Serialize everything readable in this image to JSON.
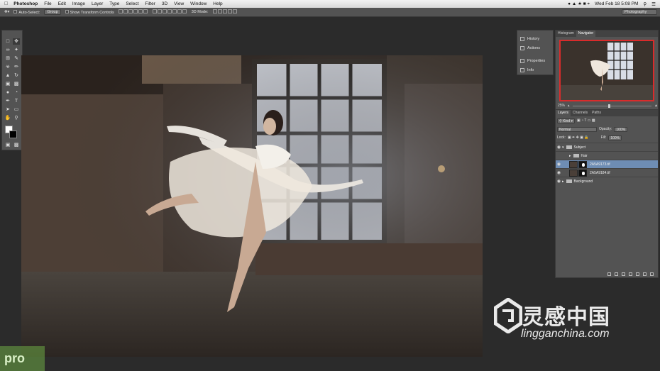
{
  "menubar": {
    "apple": "",
    "items": [
      "Photoshop",
      "File",
      "Edit",
      "Image",
      "Layer",
      "Type",
      "Select",
      "Filter",
      "3D",
      "View",
      "Window",
      "Help"
    ],
    "clock": "Wed Feb 18  5:08 PM"
  },
  "options": {
    "auto_select": "Auto-Select:",
    "auto_select_value": "Group",
    "transform_controls": "Show Transform Controls",
    "mode_3d": "3D Mode:",
    "workspace": "Photography"
  },
  "dock": {
    "items": [
      "History",
      "Actions",
      "Properties",
      "Info"
    ]
  },
  "navigator": {
    "tabs": [
      "Histogram",
      "Navigator"
    ],
    "zoom": "25%"
  },
  "layers": {
    "tabs": [
      "Layers",
      "Channels",
      "Paths"
    ],
    "kind": "Kind",
    "blend_mode": "Normal",
    "opacity_label": "Opacity:",
    "opacity": "100%",
    "lock_label": "Lock:",
    "fill_label": "Fill:",
    "fill": "100%",
    "rows": [
      {
        "name": "Subject",
        "type": "group"
      },
      {
        "name": "Hair",
        "type": "group"
      },
      {
        "name": "2A5A9173.tif",
        "type": "layer",
        "selected": true
      },
      {
        "name": "2A5A9184.tif",
        "type": "layer"
      },
      {
        "name": "Background",
        "type": "group"
      }
    ]
  },
  "branding": {
    "pro": "pro",
    "watermark_cn": "灵感中国",
    "watermark_en": "lingganchina.com"
  },
  "colors": {
    "selection": "#6e8db4",
    "navigator_frame": "#d92b2b"
  }
}
